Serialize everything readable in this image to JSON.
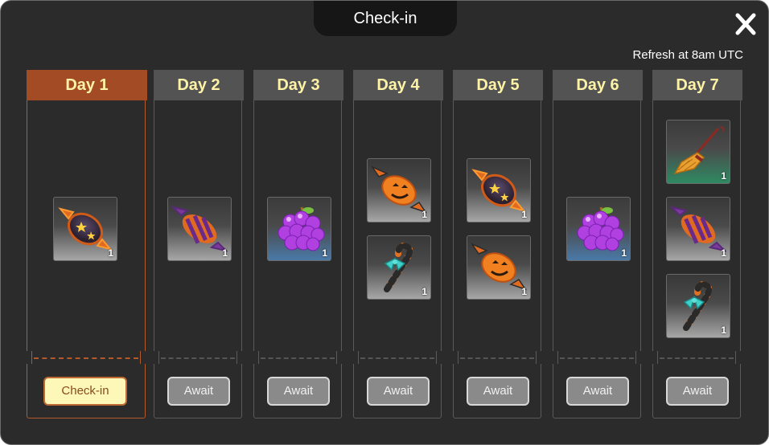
{
  "dialog": {
    "title": "Check-in",
    "refresh_note": "Refresh at 8am UTC",
    "close_icon": "close-icon"
  },
  "colors": {
    "active_header": "#a34b24",
    "inactive_header": "#535353",
    "day_text": "#fdf2a6",
    "checkin_bg": "#fdf7b8"
  },
  "days": [
    {
      "label": "Day 1",
      "button": "Check-in",
      "rewards": [
        {
          "icon": "star-candy-icon",
          "qty": "1"
        }
      ]
    },
    {
      "label": "Day 2",
      "button": "Await",
      "rewards": [
        {
          "icon": "striped-candy-icon",
          "qty": "1"
        }
      ]
    },
    {
      "label": "Day 3",
      "button": "Await",
      "rewards": [
        {
          "icon": "grapes-icon",
          "qty": "1"
        }
      ]
    },
    {
      "label": "Day 4",
      "button": "Await",
      "rewards": [
        {
          "icon": "pumpkin-candy-icon",
          "qty": "1"
        },
        {
          "icon": "candy-cane-icon",
          "qty": "1"
        }
      ]
    },
    {
      "label": "Day 5",
      "button": "Await",
      "rewards": [
        {
          "icon": "star-candy-icon",
          "qty": "1"
        },
        {
          "icon": "pumpkin-candy-icon",
          "qty": "1"
        }
      ]
    },
    {
      "label": "Day 6",
      "button": "Await",
      "rewards": [
        {
          "icon": "grapes-icon",
          "qty": "1"
        }
      ]
    },
    {
      "label": "Day 7",
      "button": "Await",
      "rewards": [
        {
          "icon": "broom-icon",
          "qty": "1"
        },
        {
          "icon": "striped-candy-icon",
          "qty": "1"
        },
        {
          "icon": "candy-cane-icon",
          "qty": "1"
        }
      ]
    }
  ]
}
